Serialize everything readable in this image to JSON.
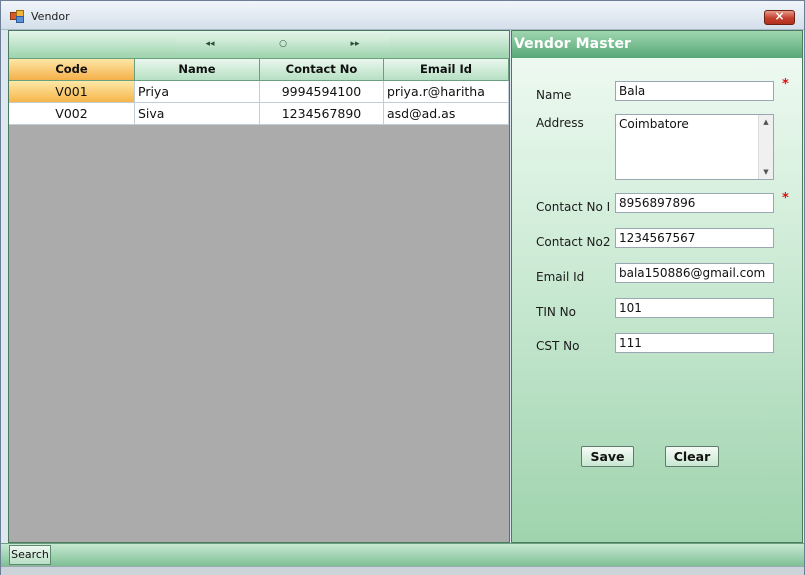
{
  "window": {
    "title": "Vendor",
    "close_glyph": "×"
  },
  "navigator": {
    "first": "◂◂",
    "current": "○",
    "last": "▸▸"
  },
  "grid": {
    "columns": [
      "Code",
      "Name",
      "Contact No",
      "Email Id"
    ],
    "rows": [
      {
        "code": "V001",
        "name": "Priya",
        "contact": "9994594100",
        "email": "priya.r@haritha"
      },
      {
        "code": "V002",
        "name": "Siva",
        "contact": "1234567890",
        "email": "asd@ad.as"
      }
    ],
    "selected_row": 0
  },
  "form": {
    "title": "Vendor Master",
    "name": {
      "label": "Name",
      "value": "Bala"
    },
    "address": {
      "label": "Address",
      "value": "Coimbatore"
    },
    "contact1": {
      "label": "Contact No I",
      "value": "8956897896"
    },
    "contact2": {
      "label": "Contact No2",
      "value": "1234567567"
    },
    "email": {
      "label": "Email Id",
      "value": "bala150886@gmail.com"
    },
    "tin": {
      "label": "TIN No",
      "value": "101"
    },
    "cst": {
      "label": "CST No",
      "value": "111"
    },
    "required_mark": "*",
    "save_label": "Save",
    "clear_label": "Clear"
  },
  "bottom": {
    "search_tab": "Search"
  },
  "icons": {
    "app": "app-icon",
    "close": "close-icon",
    "scroll_up": "scroll-up-icon",
    "scroll_down": "scroll-down-icon"
  },
  "colors": {
    "accent_green": "#56a876",
    "selected_orange": "#f6b54a",
    "required_red": "#e01010"
  }
}
